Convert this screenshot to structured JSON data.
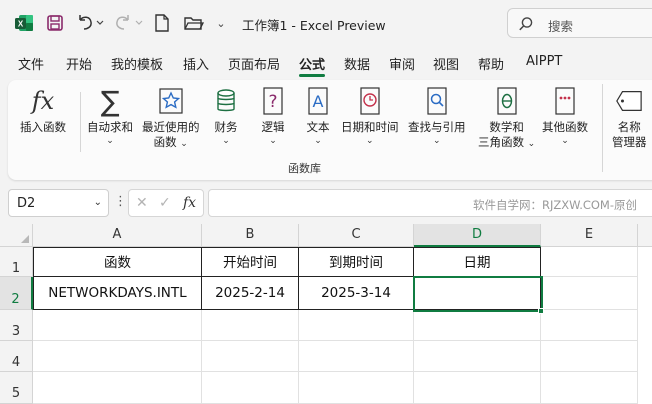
{
  "app": {
    "title": "工作簿1 - Excel Preview",
    "search_placeholder": "搜索"
  },
  "menu": {
    "tabs": [
      {
        "label": "文件"
      },
      {
        "label": "开始"
      },
      {
        "label": "我的模板"
      },
      {
        "label": "插入"
      },
      {
        "label": "页面布局"
      },
      {
        "label": "公式",
        "active": true
      },
      {
        "label": "数据"
      },
      {
        "label": "审阅"
      },
      {
        "label": "视图"
      },
      {
        "label": "帮助"
      },
      {
        "label": "AIPPT"
      }
    ]
  },
  "ribbon": {
    "insert_function": "插入函数",
    "autosum": "自动求和",
    "recent_line1": "最近使用的",
    "recent_line2": "函数",
    "financial": "财务",
    "logical": "逻辑",
    "text": "文本",
    "datetime": "日期和时间",
    "lookup": "查找与引用",
    "math_line1": "数学和",
    "math_line2": "三角函数",
    "other": "其他函数",
    "name_line1": "名称",
    "name_line2": "管理器",
    "group_label": "函数库"
  },
  "formula_bar": {
    "name_box": "D2",
    "fx_symbol": "fx",
    "watermark": "软件自学网：RJZXW.COM-原创"
  },
  "sheet": {
    "columns": [
      "A",
      "B",
      "C",
      "D",
      "E"
    ],
    "rows": [
      "1",
      "2",
      "3",
      "4",
      "5"
    ],
    "headers": [
      "函数",
      "开始时间",
      "到期时间",
      "日期"
    ],
    "row2": [
      "NETWORKDAYS.INTL",
      "2025-2-14",
      "2025-3-14",
      ""
    ],
    "active_cell": "D2"
  },
  "colors": {
    "accent": "#107c41",
    "excel_green": "#1d6f42",
    "icon_blue": "#2b6cc4",
    "icon_red": "#c4314b"
  }
}
